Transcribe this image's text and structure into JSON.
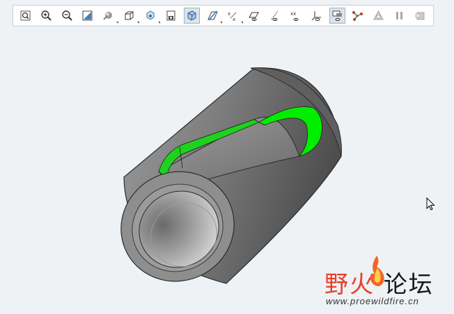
{
  "toolbar": {
    "buttons": [
      {
        "icon": "refit-icon",
        "active": false,
        "dropdown": false
      },
      {
        "icon": "zoom-in-icon",
        "active": false,
        "dropdown": false
      },
      {
        "icon": "zoom-out-icon",
        "active": false,
        "dropdown": false
      },
      {
        "icon": "repaint-icon",
        "active": false,
        "dropdown": false
      },
      {
        "icon": "display-style-icon",
        "active": false,
        "dropdown": true
      },
      {
        "icon": "saved-orientations-icon",
        "active": false,
        "dropdown": true
      },
      {
        "icon": "view-manager-icon",
        "active": false,
        "dropdown": true
      },
      {
        "icon": "perspective-view-icon",
        "active": false,
        "dropdown": false
      },
      {
        "icon": "section-view-icon",
        "active": true,
        "dropdown": false
      },
      {
        "icon": "datum-display-icon",
        "active": false,
        "dropdown": true
      },
      {
        "icon": "annotation-display-icon",
        "active": false,
        "dropdown": true
      },
      {
        "icon": "plane-display-icon",
        "active": false,
        "dropdown": false
      },
      {
        "icon": "axis-display-icon",
        "active": false,
        "dropdown": false
      },
      {
        "icon": "point-display-icon",
        "active": false,
        "dropdown": false
      },
      {
        "icon": "csys-display-icon",
        "active": false,
        "dropdown": false
      },
      {
        "icon": "spin-center-icon",
        "active": true,
        "dropdown": false
      },
      {
        "icon": "network-icon",
        "active": false,
        "dropdown": false
      },
      {
        "icon": "shading-warning-icon",
        "active": false,
        "dropdown": false
      },
      {
        "icon": "pause-icon",
        "active": false,
        "dropdown": false
      },
      {
        "icon": "stop-icon",
        "active": false,
        "dropdown": false
      }
    ]
  },
  "model": {
    "icon": "cylinder-part-model",
    "colors": {
      "body": "#8c8c8c",
      "highlight": "#00ee00",
      "edge": "#2a2a2a"
    }
  },
  "watermark": {
    "title_accent": "野火",
    "title_dark": "论坛",
    "url": "www.proewildfire.cn",
    "colors": {
      "accent": "#e8402a"
    }
  },
  "cursor": {
    "icon": "mouse-pointer-icon"
  }
}
